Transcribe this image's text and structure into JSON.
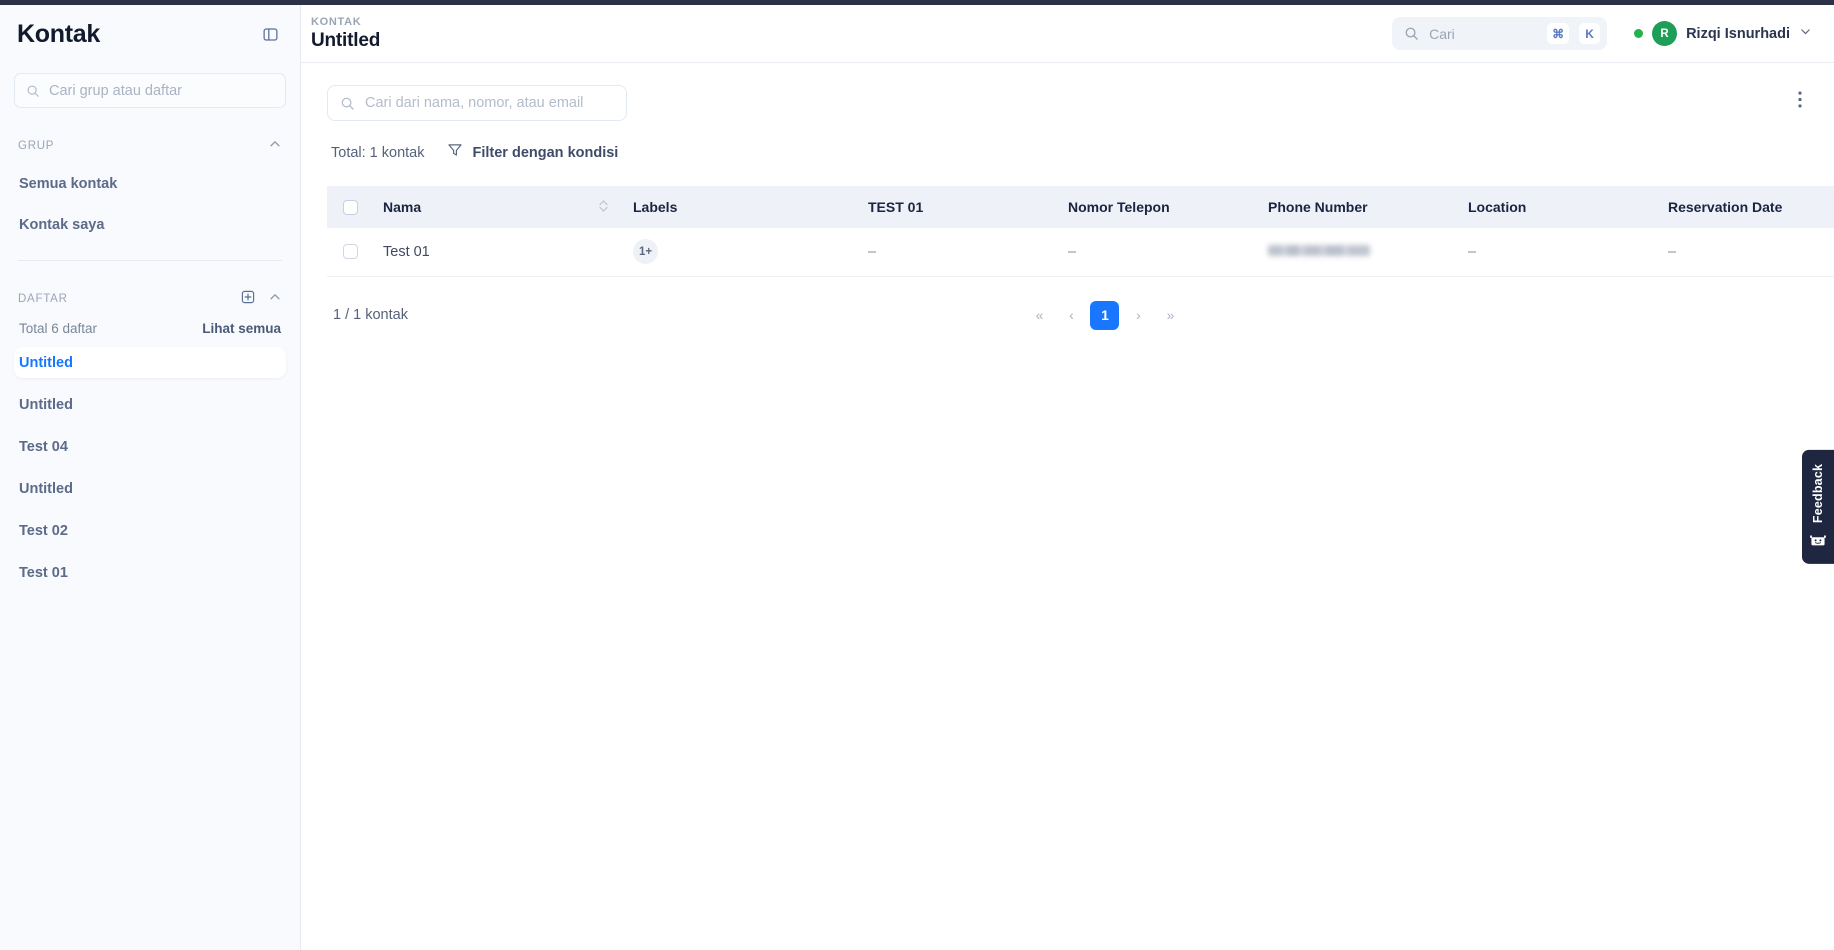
{
  "sidebar": {
    "title": "Kontak",
    "panel_toggle_icon": "panel-collapse-icon",
    "search": {
      "placeholder": "Cari grup atau daftar",
      "value": "",
      "icon": "search-icon"
    },
    "group_section": {
      "title": "GRUP",
      "collapse_icon": "chevron-up-icon",
      "items": [
        {
          "label": "Semua kontak"
        },
        {
          "label": "Kontak saya"
        }
      ]
    },
    "list_section": {
      "title": "DAFTAR",
      "add_icon": "plus-square-icon",
      "collapse_icon": "chevron-up-icon",
      "total_label": "Total 6 daftar",
      "see_all_label": "Lihat semua",
      "items": [
        {
          "label": "Untitled",
          "active": true
        },
        {
          "label": "Untitled",
          "active": false
        },
        {
          "label": "Test 04",
          "active": false
        },
        {
          "label": "Untitled",
          "active": false
        },
        {
          "label": "Test 02",
          "active": false
        },
        {
          "label": "Test 01",
          "active": false
        }
      ]
    }
  },
  "topbar": {
    "breadcrumb": "KONTAK",
    "title": "Untitled",
    "search": {
      "placeholder": "Cari",
      "value": "",
      "icon": "search-icon",
      "shortcut_modifier": "⌘",
      "shortcut_key": "K"
    },
    "user": {
      "status": "online",
      "initial": "R",
      "name": "Rizqi Isnurhadi",
      "chevron_icon": "chevron-down-icon"
    }
  },
  "content": {
    "search": {
      "placeholder": "Cari dari nama, nomor, atau email",
      "value": "",
      "icon": "search-icon"
    },
    "more_menu_icon": "kebab-menu-icon",
    "total_label": "Total: 1 kontak",
    "filter": {
      "label": "Filter dengan kondisi",
      "icon": "funnel-icon"
    },
    "table": {
      "columns": [
        {
          "label": "Nama",
          "sortable": true,
          "sort_icon": "sort-updown-icon"
        },
        {
          "label": "Labels",
          "sortable": false
        },
        {
          "label": "TEST 01",
          "sortable": false
        },
        {
          "label": "Nomor Telepon",
          "sortable": false
        },
        {
          "label": "Phone Number",
          "sortable": false
        },
        {
          "label": "Location",
          "sortable": false
        },
        {
          "label": "Reservation Date",
          "sortable": false
        }
      ],
      "rows": [
        {
          "selected": false,
          "nama": "Test 01",
          "labels_badge": "1+",
          "test_01": "–",
          "nomor_telepon": "–",
          "phone_number": "",
          "phone_number_redacted": true,
          "location": "–",
          "reservation_date": "–"
        }
      ]
    },
    "pagination": {
      "count_label": "1 / 1 kontak",
      "first_label": "«",
      "prev_label": "‹",
      "pages": [
        "1"
      ],
      "current_page": "1",
      "next_label": "›",
      "last_label": "»"
    }
  },
  "feedback": {
    "label": "Feedback",
    "icon": "smiley-robot-icon"
  },
  "colors": {
    "accent": "#1977ff",
    "online": "#23b24b",
    "avatar_bg": "#1e9e57",
    "sidebar_bg": "#f8fafd",
    "table_header_bg": "#eef2f8",
    "feedback_bg": "#1e2640"
  }
}
